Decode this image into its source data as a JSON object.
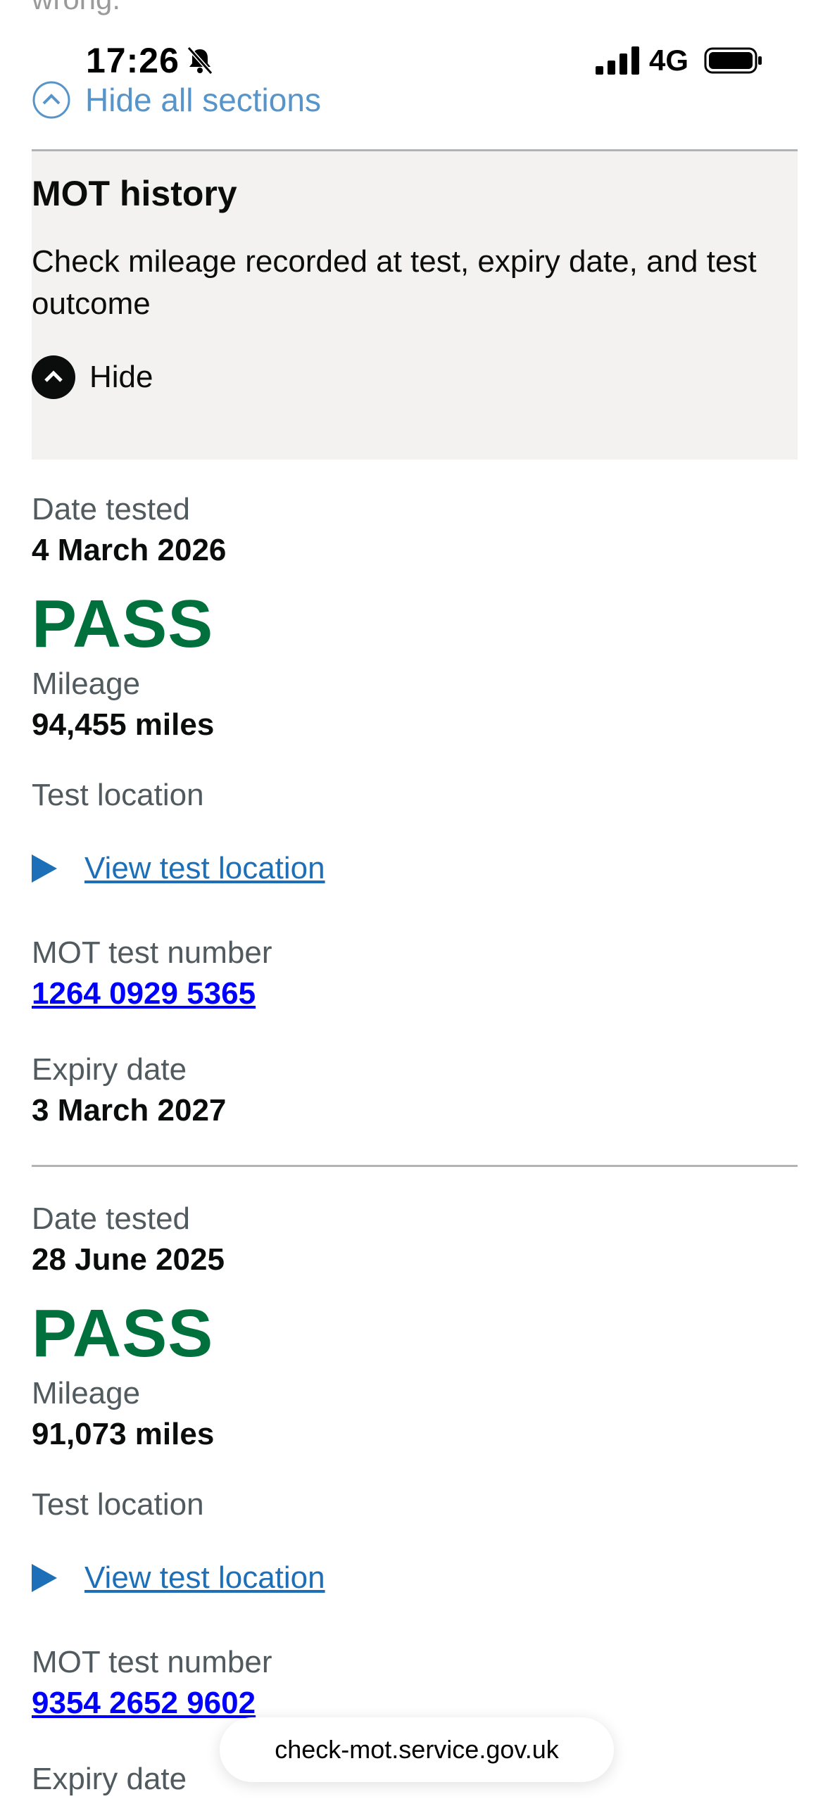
{
  "previous_text": "wrong.",
  "status_bar": {
    "time": "17:26",
    "network": "4G"
  },
  "hide_all_label": "Hide all sections",
  "section": {
    "title": "MOT history",
    "description": "Check mileage recorded at test, expiry date, and test outcome",
    "toggle_label": "Hide"
  },
  "labels": {
    "date_tested": "Date tested",
    "mileage": "Mileage",
    "test_location": "Test location",
    "view_location": "View test location",
    "test_number": "MOT test number",
    "expiry_date": "Expiry date"
  },
  "tests": [
    {
      "date": "4 March 2026",
      "result": "PASS",
      "mileage": "94,455 miles",
      "test_number": "1264 0929 5365",
      "expiry": "3 March 2027"
    },
    {
      "date": "28 June 2025",
      "result": "PASS",
      "mileage": "91,073 miles",
      "test_number": "9354 2652 9602"
    }
  ],
  "url": "check-mot.service.gov.uk",
  "colors": {
    "pass_green": "#00703c",
    "link_blue": "#1d70b8",
    "accent_light_blue": "#5694ca",
    "section_bg": "#f3f2f1"
  }
}
